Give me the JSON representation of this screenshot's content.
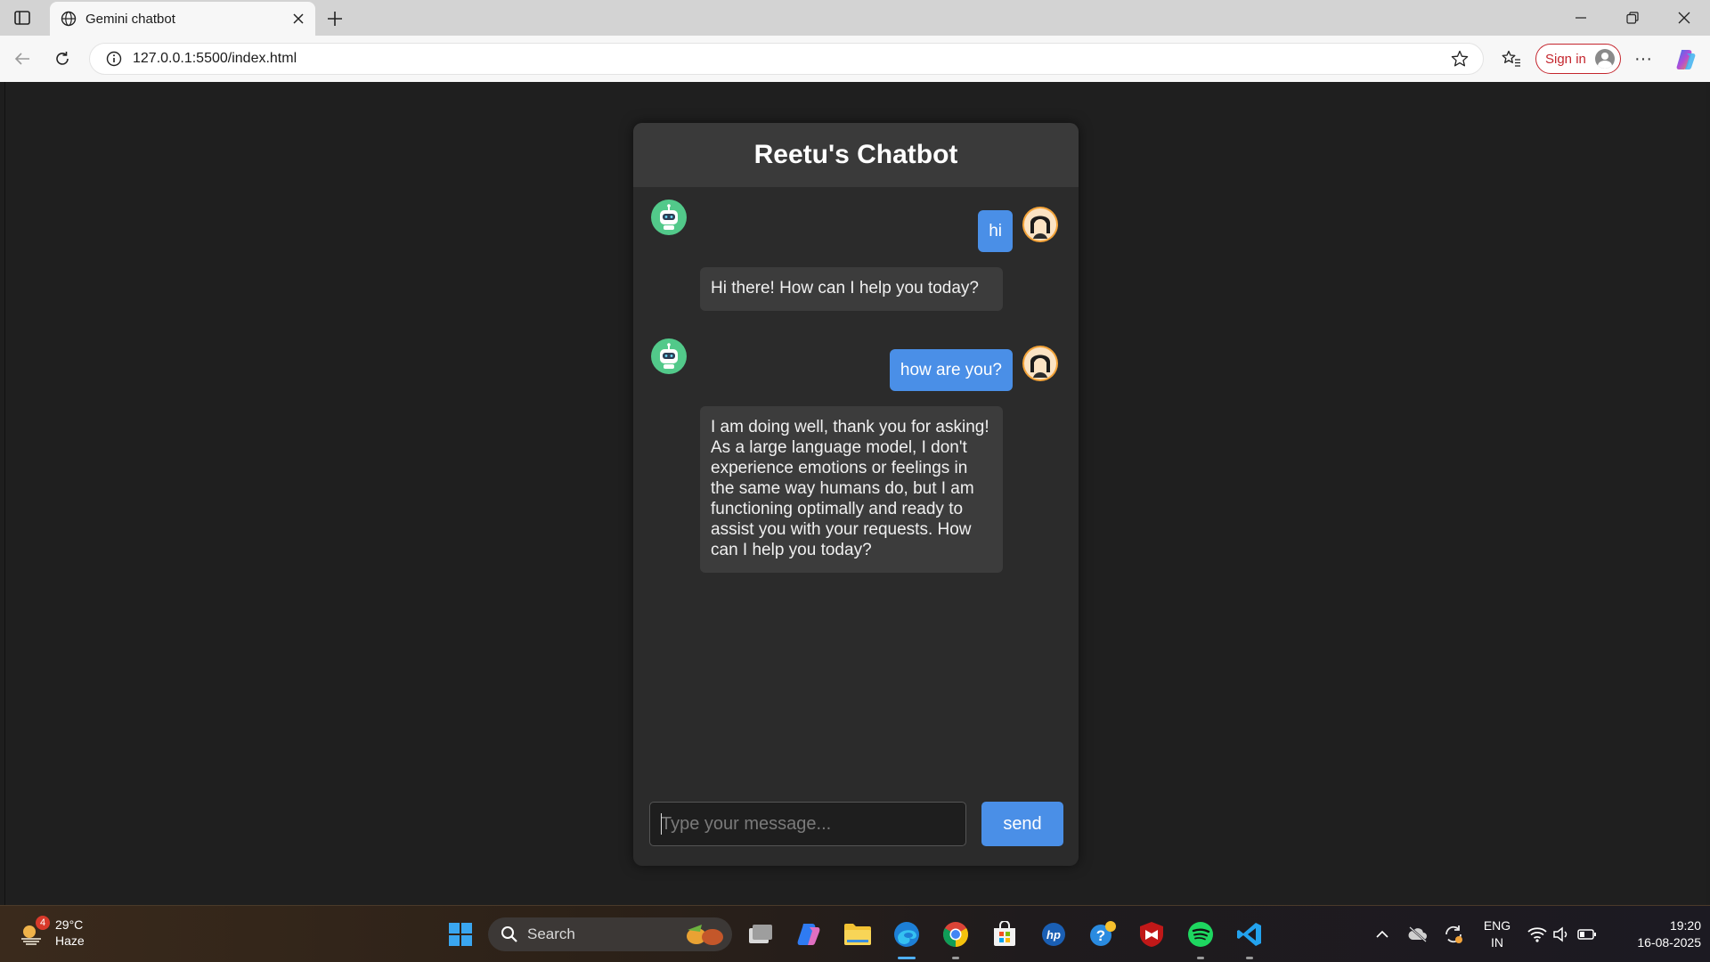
{
  "browser": {
    "tab_title": "Gemini chatbot",
    "url": "127.0.0.1:5500/index.html",
    "signin_label": "Sign in",
    "more_label": "···"
  },
  "chat": {
    "title": "Reetu's Chatbot",
    "messages": [
      {
        "sender": "user",
        "text": "hi"
      },
      {
        "sender": "bot",
        "text": "Hi there! How can I help you today?"
      },
      {
        "sender": "user",
        "text": "how are you?"
      },
      {
        "sender": "bot",
        "text": "I am doing well, thank you for asking! As a large language model, I don't experience emotions or feelings in the same way humans do, but I am functioning optimally and ready to assist you with your requests. How can I help you today?"
      }
    ],
    "input_placeholder": "Type your message...",
    "input_value": "",
    "send_label": "send"
  },
  "taskbar": {
    "weather_badge": "4",
    "temperature": "29°C",
    "condition": "Haze",
    "search_label": "Search",
    "language_line1": "ENG",
    "language_line2": "IN",
    "time": "19:20",
    "date": "16-08-2025"
  },
  "colors": {
    "user_bubble": "#4a8fe7",
    "bot_bubble": "#3c3c3c",
    "send_button": "#4a8fe7",
    "page_background": "#1f1f1f"
  }
}
